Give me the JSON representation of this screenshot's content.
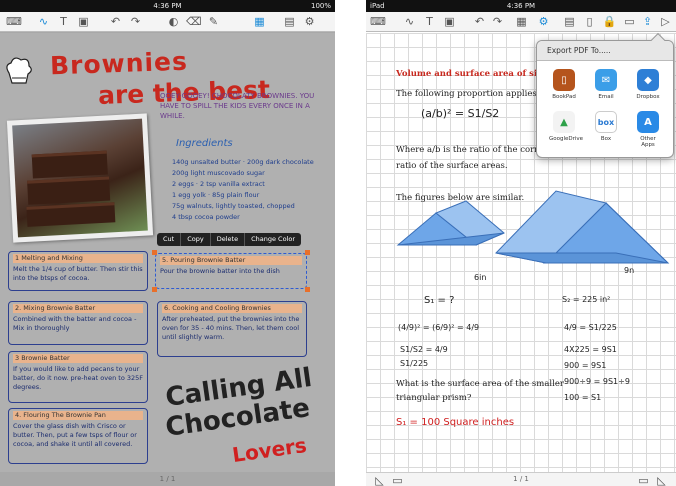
{
  "left": {
    "status": {
      "time": "4:36 PM",
      "battery": "100%"
    },
    "title": {
      "line1": "Brownies",
      "line2": "are the best"
    },
    "tagline": "Ooey-gooey! chocolaty brownies. You have to spill the kids every once in a while.",
    "ingredients_title": "Ingredients",
    "ingredients": [
      "140g unsalted butter · 200g dark chocolate",
      "200g light muscovado sugar",
      "2 eggs · 2 tsp vanilla extract",
      "1 egg yolk · 85g plain flour",
      "75g walnuts, lightly toasted, chopped",
      "4 tbsp cocoa powder"
    ],
    "context_menu": [
      "Cut",
      "Copy",
      "Delete",
      "Change Color"
    ],
    "steps": [
      {
        "head": "1 Melting and Mixing",
        "body": "Melt the 1/4 cup of butter. Then stir this into the btsps of cocoa."
      },
      {
        "head": "5. Pouring Brownie Batter",
        "body": "Pour the brownie batter into the dish"
      },
      {
        "head": "2. Mixing Brownie Batter",
        "body": "Combined with the batter and cocoa - Mix in thoroughly"
      },
      {
        "head": "6. Cooking and Cooling Brownies",
        "body": "After preheated, put the brownies into the oven for 35 - 40 mins. Then, let them cool until slightly warm."
      },
      {
        "head": "3 Brownie Batter",
        "body": "If you would like to add pecans to your batter, do it now. pre-heat oven to 325F degrees."
      },
      {
        "head": "4. Flouring The Brownie Pan",
        "body": "Cover the glass dish with Crisco or butter. Then, put a few tsps of flour or cocoa, and shake it until all covered."
      }
    ],
    "big_text": {
      "line1": "Calling All",
      "line2": "Chocolate",
      "line3": "Lovers"
    },
    "page_indicator": "1 / 1"
  },
  "right": {
    "status": {
      "carrier": "iPad",
      "time": "4:36 PM"
    },
    "heading": "Volume and surface area of simil",
    "text1": "The following proportion applies t",
    "text2": "Where a/b is the ratio of the corre",
    "text3": "ratio of the surface areas.",
    "text4": "The figures below are similar.",
    "label_s1": "S₁ = ?",
    "label_s2": "S₂ = 225 in²",
    "label_6in": "6in",
    "label_9n": "9n",
    "eq_top": "(a/b)² = S1/S2",
    "eq_left1": "(4/9)² = (6/9)² = 4/9",
    "eq_left2": "S1/S2 = 4/9",
    "eq_left3": "S1/225",
    "eq_right1": "4/9 = S1/225",
    "eq_right2": "4X225 = 9S1",
    "eq_right3": "900 = 9S1",
    "eq_right4": "900÷9 = 9S1÷9",
    "eq_right5": "100 = S1",
    "question": "What is the surface area of the smaller",
    "question2": "triangular prism?",
    "answer": "S₁ = 100 Square inches",
    "popover_title": "Export PDF To.....",
    "apps": [
      "BookPad",
      "Email",
      "Dropbox",
      "GoogleDrive",
      "Box",
      "Other Apps"
    ],
    "page_indicator": "1 / 1"
  }
}
